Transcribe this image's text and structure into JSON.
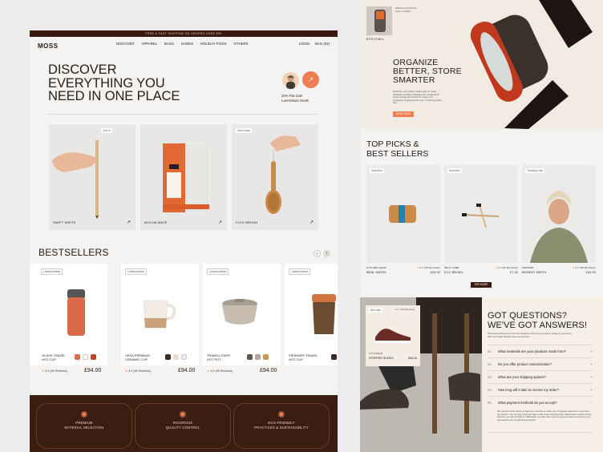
{
  "site": {
    "topbar_text": "FREE & FAST SHIPPING ON ORDERS OVER $99",
    "logo": "MOSS",
    "nav": [
      "DISCOVER",
      "APPAREL",
      "BAGS",
      "SHOES",
      "HOLIDAY PICKS",
      "OTHERS"
    ],
    "login": "LOGIN",
    "bag": "BAG",
    "bag_count": "(03)"
  },
  "hero": {
    "title_lines": [
      "DISCOVER",
      "EVERYTHING YOU",
      "NEED IN ONE PLACE"
    ],
    "promo_line1": "20% Flat Sale",
    "promo_line2": "Last-Minute Deals",
    "arrow": "↗"
  },
  "hero_cards": [
    {
      "label": "SWIFT WRITE",
      "tag": "Just in",
      "arrow": "↗"
    },
    {
      "label": "MOCHA MATE",
      "tag": "",
      "arrow": "↗"
    },
    {
      "label": "FLEX BRUSH",
      "tag": "Must have",
      "arrow": "↗"
    }
  ],
  "bestsellers": {
    "title": "BESTSELLERS",
    "prev": "‹",
    "next": "›",
    "items": [
      {
        "tag": "Limited edition",
        "name1": "GLASS TRAVEL",
        "name2": "HOT CUP",
        "rating": "4.9 (69 Reviews)",
        "price": "£94.00",
        "swatches": [
          "#d96a4a",
          "#ffffff",
          "#c8412b"
        ]
      },
      {
        "tag": "Limited edition",
        "name1": "VERA PREMIUM",
        "name2": "CERAMIC CUP",
        "rating": "4.9 (69 Reviews)",
        "price": "£94.00",
        "swatches": [
          "#3a2b24",
          "#e6ddd0",
          "#f0ebe4"
        ]
      },
      {
        "tag": "Limited edition",
        "name1": "TRAVELLOVER",
        "name2": "HOT POT",
        "rating": "4.9 (69 Reviews)",
        "price": "£94.00",
        "swatches": [
          "#5e5750",
          "#b0a79c",
          "#c49a5c"
        ]
      },
      {
        "tag": "Limited edition",
        "name1": "SIPSHAPE TRAVEL",
        "name2": "HOT CUP",
        "rating": "4.9 (69 Reviews)",
        "price": "£94.00",
        "swatches": [
          "#3a2b24"
        ]
      }
    ]
  },
  "features": [
    {
      "line1": "PREMIUM",
      "line2": "MATERIAL SELECTION"
    },
    {
      "line1": "RIGOROUS",
      "line2": "QUALITY CONTROL"
    },
    {
      "line1": "ECO-FRIENDLY",
      "line2": "PRACTICES & SUSTAINABILITY"
    }
  ],
  "organize": {
    "thumb_label": "ECO-CHILL",
    "thumb_caption": "Effortless lunchtime: Keep it chilled",
    "title_lines": [
      "ORGANIZE",
      "BETTER, STORE",
      "SMARTER"
    ],
    "body": "Maximize your kitchen space with our sleek, stackable Container Modules Set, designed for smart storage and freshness. Keep your ingredients organized and your countertop clutter-free.",
    "cta": "SHOP NOW"
  },
  "top_picks": {
    "title_lines": [
      "TOP PICKS &",
      "BEST SELLERS"
    ],
    "items": [
      {
        "tag": "Sale item",
        "cat": "KITCHEN GEAR",
        "name": "MEAL MATES",
        "rating": "4.7 (40 Reviews)",
        "price": "£34.00"
      },
      {
        "tag": "New item",
        "cat": "SELF CARE",
        "name": "ECO BRUSH",
        "rating": "4.7 (40 Reviews)",
        "price": "£7.00"
      },
      {
        "tag": "Trending now",
        "cat": "APPAREL",
        "name": "MONKEY MIRTH",
        "rating": "4.7 (40 Reviews)",
        "price": "£34.00"
      }
    ],
    "cta": "SEE MORE"
  },
  "shoe": {
    "tag": "New item",
    "rating": "4.7 (40 Reviews)",
    "cat": "FOOTWEAR",
    "name": "STEPPER SHOES",
    "price": "£65.00"
  },
  "faq": {
    "title_lines": [
      "GOT QUESTIONS?",
      "WE'VE GOT ANSWERS!"
    ],
    "intro": "Find quick solutions to common questions about our products, shipping, and more. Still need help? Reach out to us anytime!",
    "items": [
      {
        "n": "01.",
        "q": "What materials are your products made from?",
        "icon": "+"
      },
      {
        "n": "02.",
        "q": "Do you offer product customization?",
        "icon": "+"
      },
      {
        "n": "03.",
        "q": "What are your shipping options?",
        "icon": "+"
      },
      {
        "n": "04.",
        "q": "How long will it take to receive my order?",
        "icon": "+"
      },
      {
        "n": "05.",
        "q": "What payment methods do you accept?",
        "icon": "−"
      }
    ],
    "answer": "We accept a wide variety of payment methods to make your shopping experience convenient and secure. You can pay using all major credit cards including Visa, MasterCard, and American Express, as well as PayPal. Additionally, we offer other secure payment options to ensure your transactions are smooth and protected."
  },
  "colors": {
    "accent": "#ef7f52",
    "dark": "#3b1e12"
  }
}
